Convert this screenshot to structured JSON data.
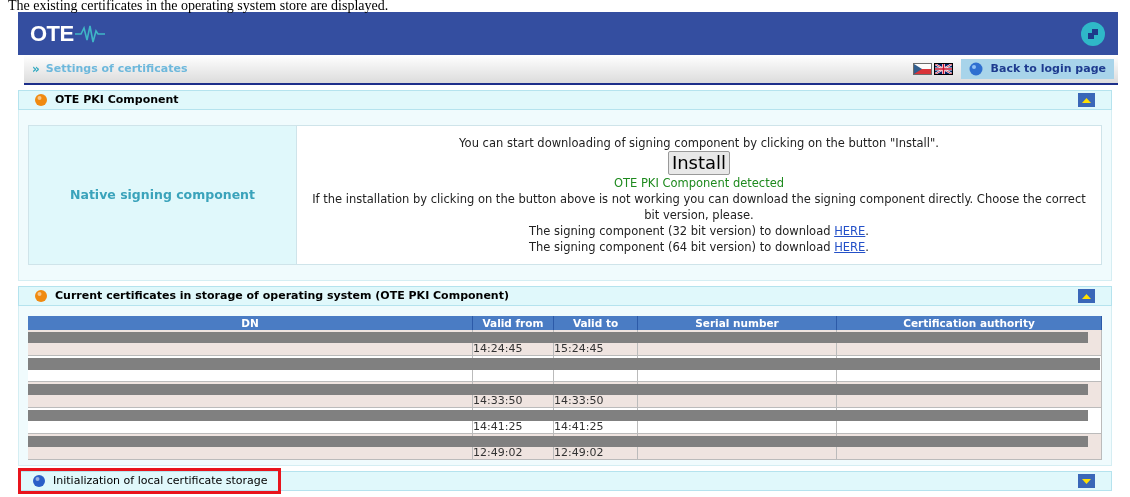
{
  "caption": "The existing certificates in the operating system store are displayed.",
  "header": {
    "logo": "OTE"
  },
  "breadcrumb": {
    "marker": "»",
    "label": "Settings of certificates"
  },
  "languages": [
    {
      "kind": "cz",
      "selected": false
    },
    {
      "kind": "en",
      "selected": true
    }
  ],
  "back_button": "Back to login page",
  "sections": [
    {
      "kind": "component",
      "title": "OTE PKI Component",
      "expanded": true,
      "highlighted": false,
      "label": "Native signing component",
      "intro": "You can start downloading of signing component by clicking on the button \"Install\".",
      "button": "Install",
      "status": "OTE PKI Component detected",
      "note": "If the installation by clicking on the button above is not working you can download the signing component directly. Choose the correct bit version, please.",
      "downloads": [
        {
          "text": "The signing component (32 bit version) to download ",
          "link": "HERE",
          "suffix": "."
        },
        {
          "text": "The signing component (64 bit version) to download ",
          "link": "HERE",
          "suffix": "."
        }
      ]
    },
    {
      "kind": "table",
      "title": "Current certificates in storage of operating system (OTE PKI Component)",
      "expanded": true,
      "highlighted": false,
      "columns": [
        "DN",
        "Valid from",
        "Valid to",
        "Serial number",
        "Certification authority"
      ],
      "rows": [
        {
          "valid_from": "14:24:45",
          "valid_to": "15:24:45"
        },
        {},
        {
          "valid_from": "14:33:50",
          "valid_to": "14:33:50"
        },
        {
          "valid_from": "14:41:25",
          "valid_to": "14:41:25"
        },
        {
          "valid_from": "12:49:02",
          "valid_to": "12:49:02"
        }
      ]
    },
    {
      "kind": "collapsed",
      "title": "Initialization of local certificate storage",
      "expanded": false,
      "highlighted": true
    }
  ]
}
